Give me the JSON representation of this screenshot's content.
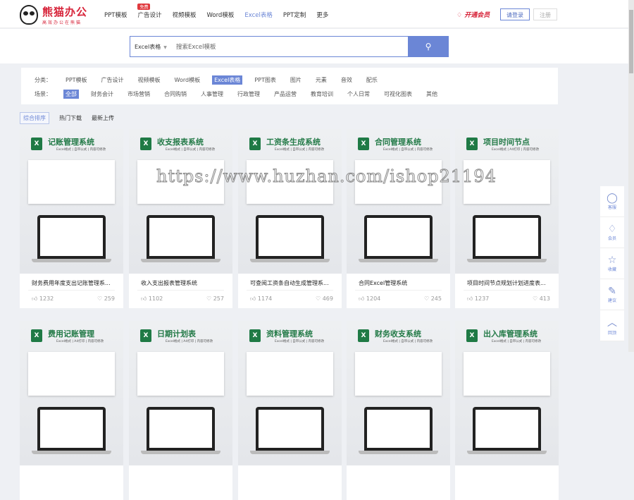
{
  "header": {
    "brand": "熊猫办公",
    "slogan": "高效办公在熊猫",
    "nav": [
      {
        "label": "PPT模板"
      },
      {
        "label": "广告设计",
        "badge": "免费"
      },
      {
        "label": "视频模板"
      },
      {
        "label": "Word模板"
      },
      {
        "label": "Excel表格",
        "active": true
      },
      {
        "label": "PPT定制"
      },
      {
        "label": "更多"
      }
    ],
    "vip": "开通会员",
    "login": "请登录",
    "register": "注册"
  },
  "search": {
    "category": "Excel表格",
    "placeholder": "搜索Excel模板"
  },
  "filter": {
    "category_label": "分类：",
    "categories": [
      "PPT模板",
      "广告设计",
      "视频模板",
      "Word模板",
      "Excel表格",
      "PPT图表",
      "图片",
      "元素",
      "音效",
      "配乐"
    ],
    "scene_label": "场景：",
    "scenes": [
      "全部",
      "财务会计",
      "市场营销",
      "合同购销",
      "人事管理",
      "行政管理",
      "产品运营",
      "教育培训",
      "个人日常",
      "可视化图表",
      "其他"
    ]
  },
  "sort": [
    "综合排序",
    "热门下载",
    "最新上传"
  ],
  "cards": [
    {
      "cover": "记账管理系统",
      "sub": "Excel格式 | 自带公式 | 内容可修改",
      "title": "财务费用年度支出记账管理系...",
      "likes": "1232",
      "favs": "259"
    },
    {
      "cover": "收支报表系统",
      "sub": "Excel格式 | 自带公式 | 内容可修改",
      "title": "收入支出报表管理系统",
      "likes": "1102",
      "favs": "257"
    },
    {
      "cover": "工资条生成系统",
      "sub": "Excel格式 | 自带公式 | 内容可修改",
      "title": "可查阅工资条自动生成管理系...",
      "likes": "1174",
      "favs": "469"
    },
    {
      "cover": "合同管理系统",
      "sub": "Excel格式 | 自带公式 | 内容可修改",
      "title": "合同Excel管理系统",
      "likes": "1204",
      "favs": "245"
    },
    {
      "cover": "项目时间节点",
      "sub": "Excel格式 | A4打印 | 内容可修改",
      "title": "项目时间节点规划计划进度表...",
      "likes": "1237",
      "favs": "413"
    },
    {
      "cover": "费用记账管理",
      "sub": "Excel格式 | A4打印 | 内容可修改"
    },
    {
      "cover": "日期计划表",
      "sub": "Excel格式 | A4打印 | 内容可修改"
    },
    {
      "cover": "资料管理系统",
      "sub": "Excel格式 | 自带公式 | 内容可修改"
    },
    {
      "cover": "财务收支系统",
      "sub": "Excel格式 | 自带公式 | 内容可修改"
    },
    {
      "cover": "出入库管理系统",
      "sub": "Excel格式 | 自带公式 | 内容可修改"
    }
  ],
  "sidebar": [
    "客服",
    "会员",
    "收藏",
    "建议",
    "回顶"
  ],
  "watermark": "https://www.huzhan.com/ishop21194"
}
